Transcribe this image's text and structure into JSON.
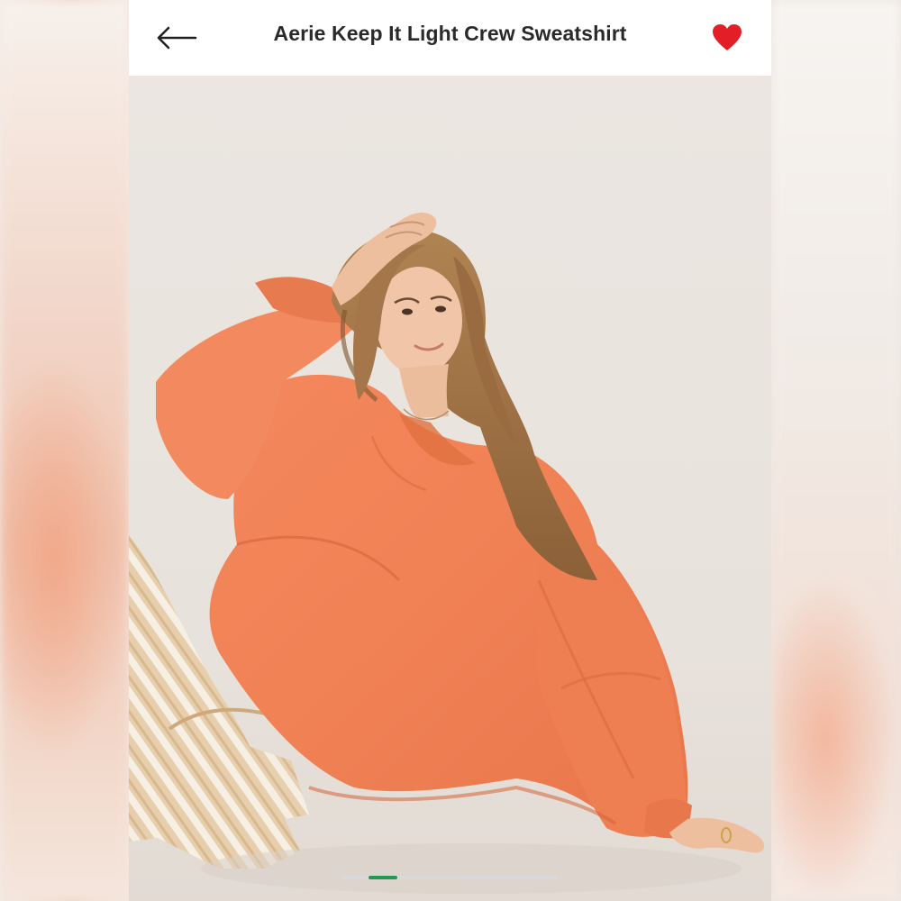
{
  "header": {
    "title": "Aerie Keep It Light Crew Sweatshirt",
    "back_icon": "arrow-left-icon",
    "favorite_icon": "heart-icon",
    "favorite_color": "#e41e26"
  },
  "gallery": {
    "image": "product-photo",
    "current_page": 2,
    "accent_color": "#1f9a55"
  }
}
